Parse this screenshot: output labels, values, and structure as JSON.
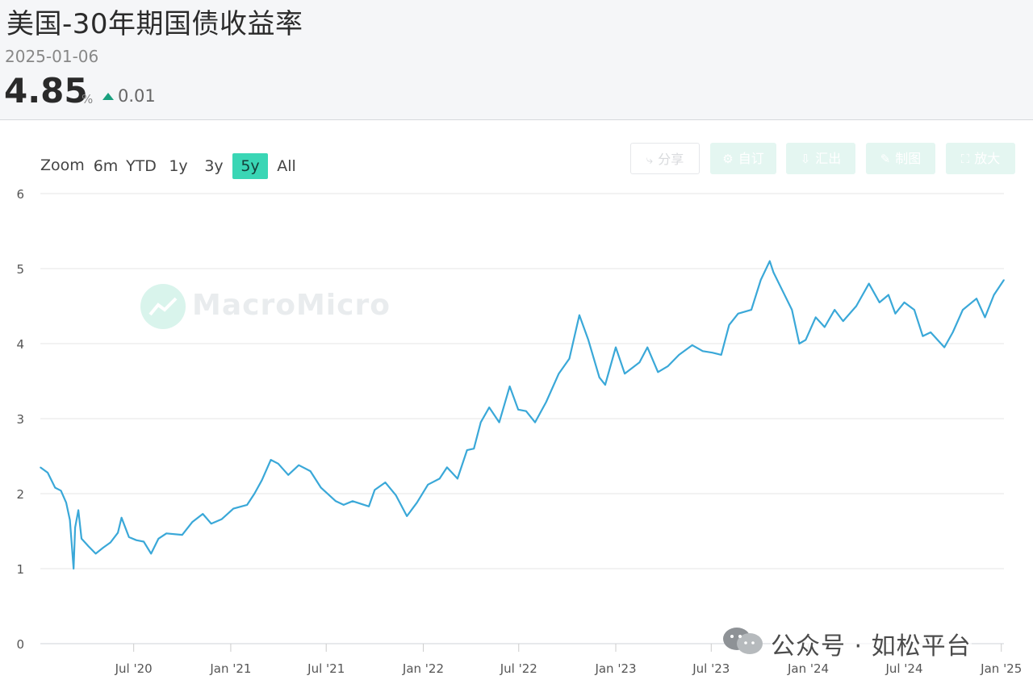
{
  "header": {
    "title": "美国-30年期国债收益率",
    "date": "2025-01-06",
    "value": "4.85",
    "unit": "%",
    "change": "0.01",
    "change_direction": "up",
    "change_color": "#19a07f"
  },
  "range_selector": {
    "label": "Zoom",
    "buttons": [
      "6m",
      "YTD",
      "1y",
      "3y",
      "5y",
      "All"
    ],
    "active": "5y",
    "active_color": "#3ad6b5"
  },
  "toolbar": {
    "share": {
      "label": "分享",
      "icon": "share-icon"
    },
    "subscribe": {
      "label": "自订",
      "icon": "gear-icon"
    },
    "export": {
      "label": "汇出",
      "icon": "download-icon"
    },
    "draw": {
      "label": "制图",
      "icon": "pencil-icon"
    },
    "fullscreen": {
      "label": "放大",
      "icon": "expand-icon"
    }
  },
  "watermark": {
    "text": "MacroMicro"
  },
  "wechat_overlay": {
    "text": "公众号 · 如松平台",
    "icon": "wechat-icon"
  },
  "chart_data": {
    "type": "line",
    "title": "",
    "xlabel": "",
    "ylabel": "",
    "ylim": [
      0,
      6
    ],
    "yticks": [
      "0",
      "1",
      "2",
      "3",
      "4",
      "5",
      "6"
    ],
    "xticks": [
      {
        "label": "Jul '20",
        "date": "2020-07-01"
      },
      {
        "label": "Jan '21",
        "date": "2021-01-01"
      },
      {
        "label": "Jul '21",
        "date": "2021-07-01"
      },
      {
        "label": "Jan '22",
        "date": "2022-01-01"
      },
      {
        "label": "Jul '22",
        "date": "2022-07-01"
      },
      {
        "label": "Jan '23",
        "date": "2023-01-01"
      },
      {
        "label": "Jul '23",
        "date": "2023-07-01"
      },
      {
        "label": "Jan '24",
        "date": "2024-01-01"
      },
      {
        "label": "Jul '24",
        "date": "2024-07-01"
      },
      {
        "label": "Jan '25",
        "date": "2025-01-01"
      }
    ],
    "xlim": [
      "2020-01-06",
      "2025-01-06"
    ],
    "grid": true,
    "line_color": "#3aa8d8",
    "series": [
      {
        "points": [
          [
            "2020-01-06",
            2.35
          ],
          [
            "2020-01-20",
            2.28
          ],
          [
            "2020-02-03",
            2.08
          ],
          [
            "2020-02-14",
            2.04
          ],
          [
            "2020-02-24",
            1.88
          ],
          [
            "2020-03-02",
            1.65
          ],
          [
            "2020-03-09",
            1.0
          ],
          [
            "2020-03-12",
            1.55
          ],
          [
            "2020-03-18",
            1.78
          ],
          [
            "2020-03-24",
            1.4
          ],
          [
            "2020-04-06",
            1.3
          ],
          [
            "2020-04-20",
            1.2
          ],
          [
            "2020-05-04",
            1.28
          ],
          [
            "2020-05-18",
            1.35
          ],
          [
            "2020-06-01",
            1.48
          ],
          [
            "2020-06-08",
            1.68
          ],
          [
            "2020-06-22",
            1.42
          ],
          [
            "2020-07-06",
            1.38
          ],
          [
            "2020-07-20",
            1.36
          ],
          [
            "2020-08-03",
            1.2
          ],
          [
            "2020-08-17",
            1.4
          ],
          [
            "2020-09-01",
            1.47
          ],
          [
            "2020-10-01",
            1.45
          ],
          [
            "2020-10-20",
            1.62
          ],
          [
            "2020-11-09",
            1.73
          ],
          [
            "2020-11-25",
            1.6
          ],
          [
            "2020-12-15",
            1.66
          ],
          [
            "2021-01-06",
            1.8
          ],
          [
            "2021-02-01",
            1.85
          ],
          [
            "2021-02-15",
            2.0
          ],
          [
            "2021-03-01",
            2.18
          ],
          [
            "2021-03-18",
            2.45
          ],
          [
            "2021-04-01",
            2.4
          ],
          [
            "2021-04-20",
            2.25
          ],
          [
            "2021-05-10",
            2.38
          ],
          [
            "2021-06-01",
            2.3
          ],
          [
            "2021-06-21",
            2.08
          ],
          [
            "2021-07-19",
            1.9
          ],
          [
            "2021-08-03",
            1.85
          ],
          [
            "2021-08-20",
            1.9
          ],
          [
            "2021-09-20",
            1.83
          ],
          [
            "2021-10-01",
            2.05
          ],
          [
            "2021-10-21",
            2.15
          ],
          [
            "2021-11-10",
            1.98
          ],
          [
            "2021-12-01",
            1.7
          ],
          [
            "2021-12-20",
            1.88
          ],
          [
            "2022-01-10",
            2.12
          ],
          [
            "2022-02-01",
            2.2
          ],
          [
            "2022-02-15",
            2.35
          ],
          [
            "2022-03-07",
            2.2
          ],
          [
            "2022-03-25",
            2.58
          ],
          [
            "2022-04-07",
            2.6
          ],
          [
            "2022-04-20",
            2.95
          ],
          [
            "2022-05-06",
            3.15
          ],
          [
            "2022-05-25",
            2.95
          ],
          [
            "2022-06-14",
            3.43
          ],
          [
            "2022-06-30",
            3.12
          ],
          [
            "2022-07-15",
            3.1
          ],
          [
            "2022-08-01",
            2.95
          ],
          [
            "2022-08-22",
            3.22
          ],
          [
            "2022-09-15",
            3.6
          ],
          [
            "2022-10-05",
            3.8
          ],
          [
            "2022-10-24",
            4.38
          ],
          [
            "2022-11-10",
            4.05
          ],
          [
            "2022-12-01",
            3.55
          ],
          [
            "2022-12-12",
            3.45
          ],
          [
            "2023-01-01",
            3.95
          ],
          [
            "2023-01-18",
            3.6
          ],
          [
            "2023-02-15",
            3.75
          ],
          [
            "2023-03-02",
            3.95
          ],
          [
            "2023-03-22",
            3.62
          ],
          [
            "2023-04-10",
            3.7
          ],
          [
            "2023-05-01",
            3.85
          ],
          [
            "2023-05-26",
            3.98
          ],
          [
            "2023-06-15",
            3.9
          ],
          [
            "2023-07-03",
            3.88
          ],
          [
            "2023-07-20",
            3.85
          ],
          [
            "2023-08-04",
            4.25
          ],
          [
            "2023-08-21",
            4.4
          ],
          [
            "2023-09-15",
            4.45
          ],
          [
            "2023-10-03",
            4.85
          ],
          [
            "2023-10-20",
            5.1
          ],
          [
            "2023-10-27",
            4.95
          ],
          [
            "2023-11-10",
            4.75
          ],
          [
            "2023-12-01",
            4.45
          ],
          [
            "2023-12-15",
            4.0
          ],
          [
            "2023-12-27",
            4.05
          ],
          [
            "2024-01-15",
            4.35
          ],
          [
            "2024-02-01",
            4.22
          ],
          [
            "2024-02-20",
            4.45
          ],
          [
            "2024-03-07",
            4.3
          ],
          [
            "2024-04-01",
            4.5
          ],
          [
            "2024-04-25",
            4.8
          ],
          [
            "2024-05-15",
            4.55
          ],
          [
            "2024-06-01",
            4.65
          ],
          [
            "2024-06-14",
            4.4
          ],
          [
            "2024-07-01",
            4.55
          ],
          [
            "2024-07-20",
            4.45
          ],
          [
            "2024-08-05",
            4.1
          ],
          [
            "2024-08-20",
            4.15
          ],
          [
            "2024-09-15",
            3.95
          ],
          [
            "2024-10-01",
            4.15
          ],
          [
            "2024-10-20",
            4.45
          ],
          [
            "2024-11-15",
            4.6
          ],
          [
            "2024-12-01",
            4.35
          ],
          [
            "2024-12-18",
            4.65
          ],
          [
            "2025-01-06",
            4.85
          ]
        ]
      }
    ]
  }
}
